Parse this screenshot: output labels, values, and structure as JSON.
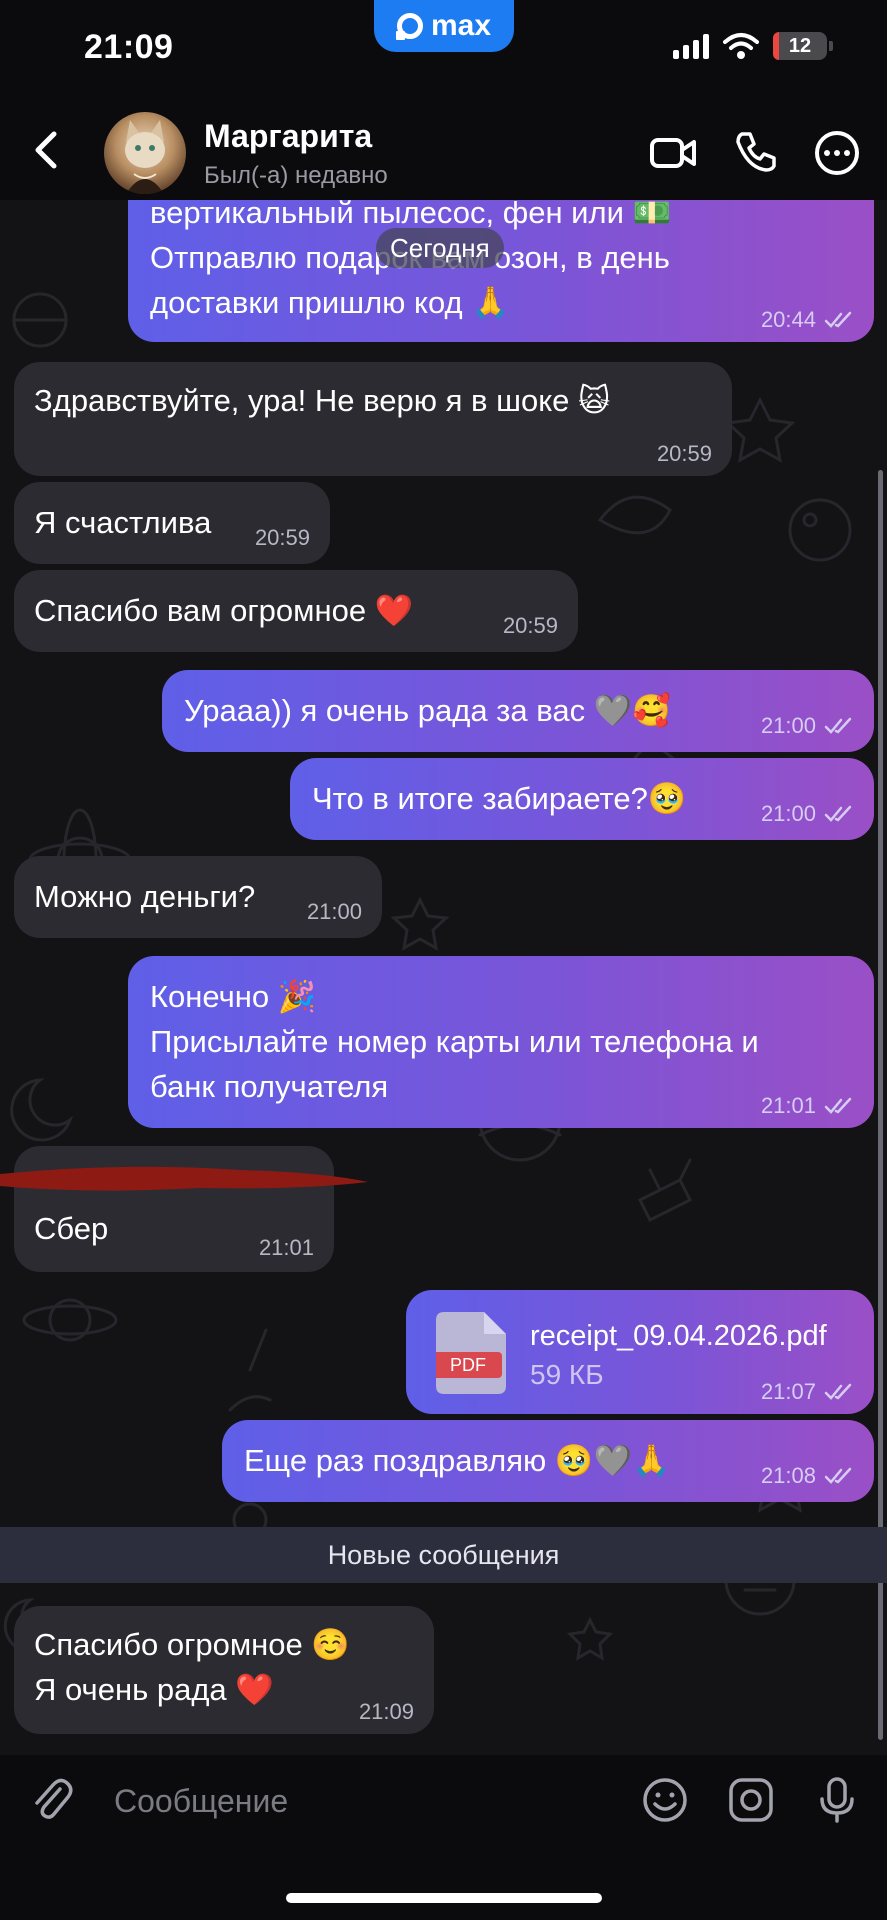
{
  "status_bar": {
    "time": "21:09",
    "app_pill": "max",
    "battery": "12",
    "battery_level": 0.12
  },
  "header": {
    "name": "Маргарита",
    "status": "Был(-а) недавно"
  },
  "date_chip": "Сегодня",
  "messages": [
    {
      "dir": "out",
      "lines": [
        "вертикальный пылесос, фен или 💵",
        "Отправлю подарок вам озон, в день",
        "доставки пришлю код 🙏"
      ],
      "time": "20:44"
    },
    {
      "dir": "in",
      "lines": [
        "Здравствуйте,  ура! Не верю я в шоке 🙀"
      ],
      "time": "20:59"
    },
    {
      "dir": "in",
      "lines": [
        "Я счастлива"
      ],
      "time": "20:59"
    },
    {
      "dir": "in",
      "lines": [
        "Спасибо вам огромное ❤️"
      ],
      "time": "20:59"
    },
    {
      "dir": "out",
      "lines": [
        "Урааа)) я очень рада за вас 🩶🥰"
      ],
      "time": "21:00"
    },
    {
      "dir": "out",
      "lines": [
        "Что в итоге забираете?🥹"
      ],
      "time": "21:00"
    },
    {
      "dir": "in",
      "lines": [
        "Можно деньги?"
      ],
      "time": "21:00"
    },
    {
      "dir": "out",
      "lines": [
        "Конечно 🎉",
        "Присылайте номер карты или телефона и",
        "банк получателя"
      ],
      "time": "21:01"
    },
    {
      "dir": "in",
      "lines": [
        "Сбер"
      ],
      "time": "21:01"
    },
    {
      "dir": "out",
      "file": {
        "name": "receipt_09.04.2026.pdf",
        "size": "59 КБ",
        "badge": "PDF"
      },
      "time": "21:07"
    },
    {
      "dir": "out",
      "lines": [
        "Еще раз поздравляю 🥹🩶🙏"
      ],
      "time": "21:08"
    },
    {
      "dir": "in",
      "lines": [
        "Спасибо огромное ☺️",
        "Я очень рада ❤️"
      ],
      "time": "21:09"
    }
  ],
  "new_messages_label": "Новые сообщения",
  "composer": {
    "placeholder": "Сообщение"
  }
}
